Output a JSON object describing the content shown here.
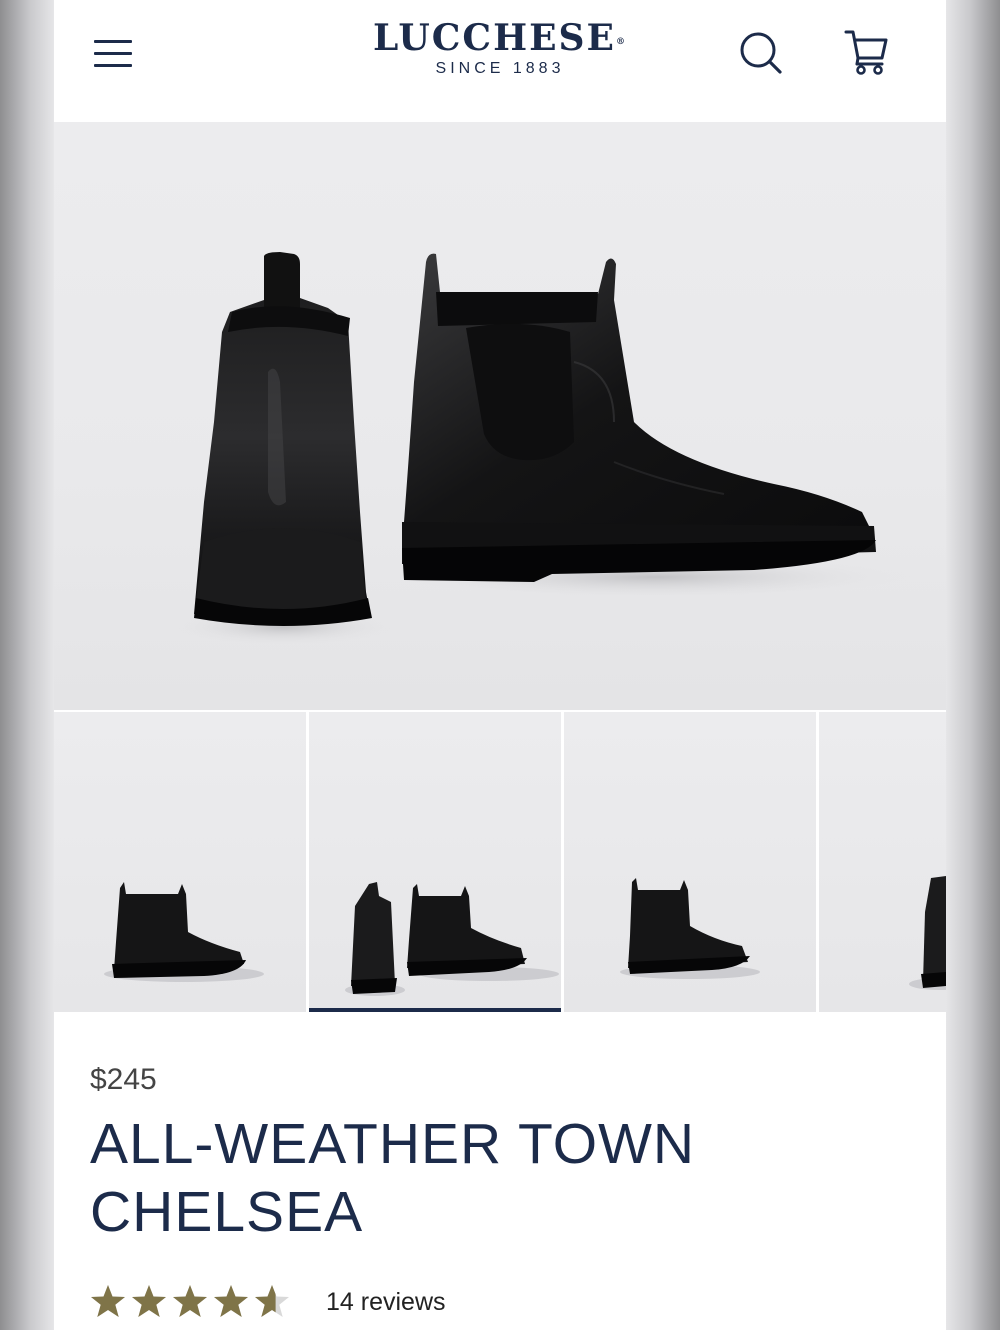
{
  "header": {
    "brand": "LUCCHESE",
    "brand_mark": "®",
    "tagline": "SINCE 1883",
    "menu_icon": "hamburger-menu-icon",
    "search_icon": "search-icon",
    "cart_icon": "shopping-cart-icon"
  },
  "gallery": {
    "thumbnail_count": 4,
    "active_thumbnail": 2
  },
  "product": {
    "price": "$245",
    "title": "ALL-WEATHER TOWN CHELSEA",
    "rating": 4.6,
    "rating_max": 5,
    "reviews_label": "14 reviews"
  },
  "colors": {
    "brand_navy": "#1c2b4a",
    "star_gold": "#7f7448",
    "star_empty": "#d9d9d9"
  }
}
